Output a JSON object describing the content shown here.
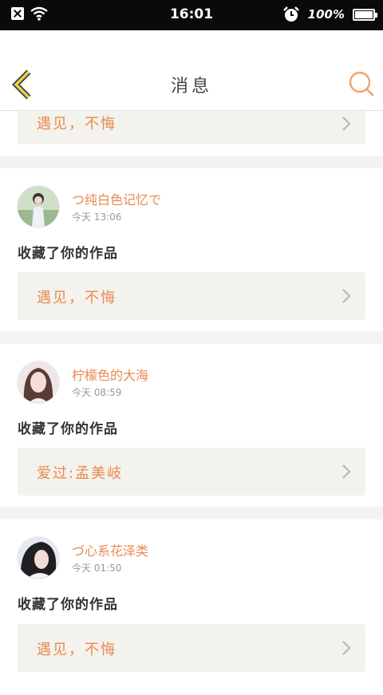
{
  "status_bar": {
    "time": "16:01",
    "battery": "100%",
    "icons": [
      "notification-x-icon",
      "wifi-icon",
      "alarm-icon",
      "battery-icon"
    ]
  },
  "header": {
    "title": "消息",
    "back_icon": "chevron-left-icon",
    "search_icon": "search-icon"
  },
  "colors": {
    "accent": "#e98a52",
    "back_arrow": "#d7c23a",
    "card_bg": "#ffffff",
    "page_bg": "#f3f3f3",
    "work_bg": "#f3f2ec"
  },
  "messages": [
    {
      "partial": true,
      "work_title": "遇见，不悔"
    },
    {
      "user": "つ纯白色记忆で",
      "time": "今天 13:06",
      "action": "收藏了你的作品",
      "work_title": "遇见，不悔"
    },
    {
      "user": "柠檬色的大海",
      "time": "今天 08:59",
      "action": "收藏了你的作品",
      "work_title": "爱过:孟美岐"
    },
    {
      "user": "づ心系花泽类",
      "time": "今天 01:50",
      "action": "收藏了你的作品",
      "work_title": "遇见，不悔"
    }
  ]
}
